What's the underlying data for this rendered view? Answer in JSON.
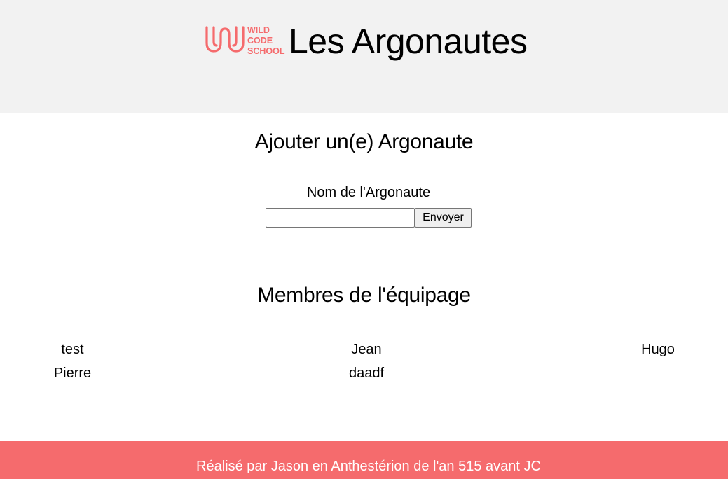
{
  "header": {
    "logo_text": [
      "WILD",
      "CODE",
      "SCHOOL"
    ],
    "title": "Les Argonautes",
    "background": "#f2f2f2"
  },
  "add_form": {
    "title": "Ajouter un(e) Argonaute",
    "label": "Nom de l'Argonaute",
    "input_value": "",
    "input_placeholder": "",
    "submit_label": "Envoyer"
  },
  "crew": {
    "title": "Membres de l'équipage",
    "members": [
      "test",
      "Jean",
      "Hugo",
      "Pierre",
      "daadf"
    ]
  },
  "footer": {
    "text": "Réalisé par Jason en Anthestérion de l'an 515 avant JC",
    "background": "#f56b6d"
  },
  "colors": {
    "accent": "#f56b6d"
  }
}
